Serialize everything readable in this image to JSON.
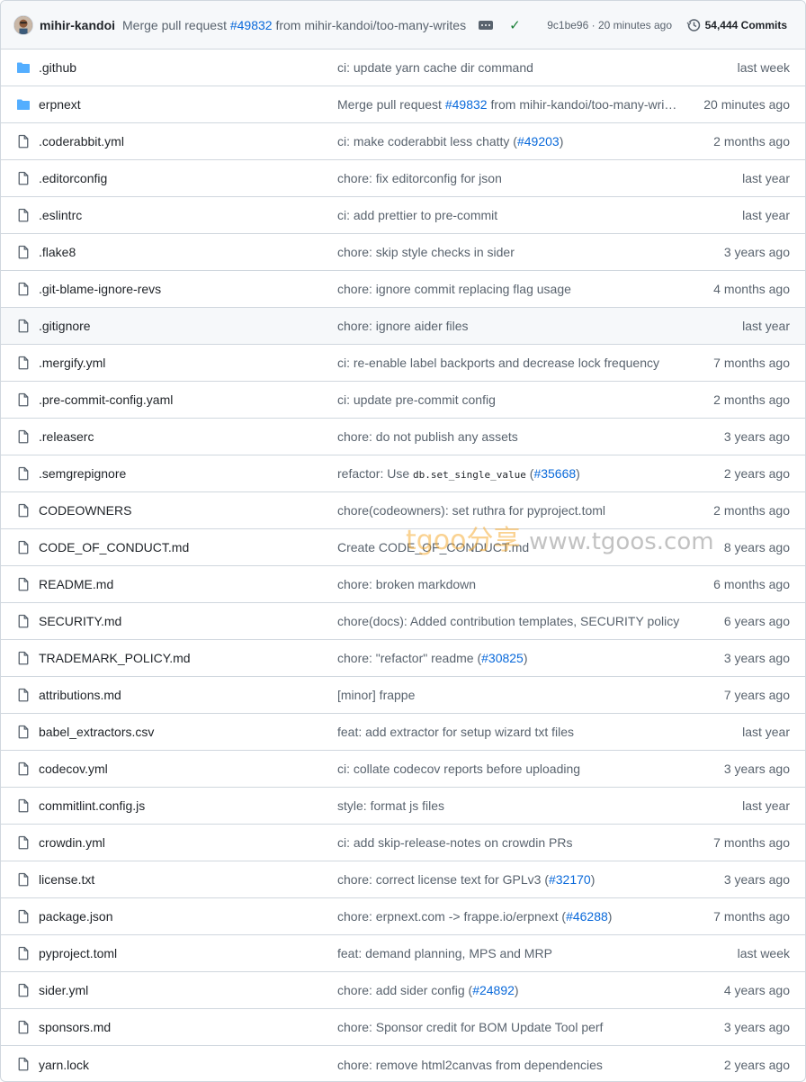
{
  "header": {
    "author": "mihir-kandoi",
    "message_prefix": "Merge pull request ",
    "message_link": "#49832",
    "message_suffix": " from mihir-kandoi/too-many-writes",
    "sha_time": "9c1be96 · 20 minutes ago",
    "commits": "54,444 Commits",
    "icons": [
      "avatar",
      "ellipsis-icon",
      "check-icon",
      "history-icon"
    ]
  },
  "rows": [
    {
      "name": ".github",
      "type": "dir",
      "msg": [
        {
          "t": "ci: update yarn cache dir command"
        }
      ],
      "age": "last week"
    },
    {
      "name": "erpnext",
      "type": "dir",
      "msg": [
        {
          "t": "Merge pull request "
        },
        {
          "t": "#49832",
          "link": true
        },
        {
          "t": " from mihir-kandoi/too-many-wri…"
        }
      ],
      "age": "20 minutes ago"
    },
    {
      "name": ".coderabbit.yml",
      "type": "file",
      "msg": [
        {
          "t": "ci: make coderabbit less chatty ("
        },
        {
          "t": "#49203",
          "link": true
        },
        {
          "t": ")"
        }
      ],
      "age": "2 months ago"
    },
    {
      "name": ".editorconfig",
      "type": "file",
      "msg": [
        {
          "t": "chore: fix editorconfig for json"
        }
      ],
      "age": "last year"
    },
    {
      "name": ".eslintrc",
      "type": "file",
      "msg": [
        {
          "t": "ci: add prettier to pre-commit"
        }
      ],
      "age": "last year"
    },
    {
      "name": ".flake8",
      "type": "file",
      "msg": [
        {
          "t": "chore: skip style checks in sider"
        }
      ],
      "age": "3 years ago"
    },
    {
      "name": ".git-blame-ignore-revs",
      "type": "file",
      "msg": [
        {
          "t": "chore: ignore commit replacing flag usage"
        }
      ],
      "age": "4 months ago"
    },
    {
      "name": ".gitignore",
      "type": "file",
      "msg": [
        {
          "t": "chore: ignore aider files"
        }
      ],
      "age": "last year",
      "highlight": true
    },
    {
      "name": ".mergify.yml",
      "type": "file",
      "msg": [
        {
          "t": "ci: re-enable label backports and decrease lock frequency"
        }
      ],
      "age": "7 months ago"
    },
    {
      "name": ".pre-commit-config.yaml",
      "type": "file",
      "msg": [
        {
          "t": "ci: update pre-commit config"
        }
      ],
      "age": "2 months ago"
    },
    {
      "name": ".releaserc",
      "type": "file",
      "msg": [
        {
          "t": "chore: do not publish any assets"
        }
      ],
      "age": "3 years ago"
    },
    {
      "name": ".semgrepignore",
      "type": "file",
      "msg": [
        {
          "t": "refactor: Use "
        },
        {
          "t": "db.set_single_value",
          "code": true
        },
        {
          "t": " ("
        },
        {
          "t": "#35668",
          "link": true
        },
        {
          "t": ")"
        }
      ],
      "age": "2 years ago"
    },
    {
      "name": "CODEOWNERS",
      "type": "file",
      "msg": [
        {
          "t": "chore(codeowners): set ruthra for pyproject.toml"
        }
      ],
      "age": "2 months ago"
    },
    {
      "name": "CODE_OF_CONDUCT.md",
      "type": "file",
      "msg": [
        {
          "t": "Create CODE_OF_CONDUCT.md"
        }
      ],
      "age": "8 years ago"
    },
    {
      "name": "README.md",
      "type": "file",
      "msg": [
        {
          "t": "chore: broken markdown"
        }
      ],
      "age": "6 months ago"
    },
    {
      "name": "SECURITY.md",
      "type": "file",
      "msg": [
        {
          "t": "chore(docs): Added contribution templates, SECURITY policy"
        }
      ],
      "age": "6 years ago"
    },
    {
      "name": "TRADEMARK_POLICY.md",
      "type": "file",
      "msg": [
        {
          "t": "chore: \"refactor\" readme ("
        },
        {
          "t": "#30825",
          "link": true
        },
        {
          "t": ")"
        }
      ],
      "age": "3 years ago"
    },
    {
      "name": "attributions.md",
      "type": "file",
      "msg": [
        {
          "t": "[minor] frappe"
        }
      ],
      "age": "7 years ago"
    },
    {
      "name": "babel_extractors.csv",
      "type": "file",
      "msg": [
        {
          "t": "feat: add extractor for setup wizard txt files"
        }
      ],
      "age": "last year"
    },
    {
      "name": "codecov.yml",
      "type": "file",
      "msg": [
        {
          "t": "ci: collate codecov reports before uploading"
        }
      ],
      "age": "3 years ago"
    },
    {
      "name": "commitlint.config.js",
      "type": "file",
      "msg": [
        {
          "t": "style: format js files"
        }
      ],
      "age": "last year"
    },
    {
      "name": "crowdin.yml",
      "type": "file",
      "msg": [
        {
          "t": "ci: add skip-release-notes on crowdin PRs"
        }
      ],
      "age": "7 months ago"
    },
    {
      "name": "license.txt",
      "type": "file",
      "msg": [
        {
          "t": "chore: correct license text for GPLv3 ("
        },
        {
          "t": "#32170",
          "link": true
        },
        {
          "t": ")"
        }
      ],
      "age": "3 years ago"
    },
    {
      "name": "package.json",
      "type": "file",
      "msg": [
        {
          "t": "chore: erpnext.com -> frappe.io/erpnext ("
        },
        {
          "t": "#46288",
          "link": true
        },
        {
          "t": ")"
        }
      ],
      "age": "7 months ago"
    },
    {
      "name": "pyproject.toml",
      "type": "file",
      "msg": [
        {
          "t": "feat: demand planning, MPS and MRP"
        }
      ],
      "age": "last week"
    },
    {
      "name": "sider.yml",
      "type": "file",
      "msg": [
        {
          "t": "chore: add sider config ("
        },
        {
          "t": "#24892",
          "link": true
        },
        {
          "t": ")"
        }
      ],
      "age": "4 years ago"
    },
    {
      "name": "sponsors.md",
      "type": "file",
      "msg": [
        {
          "t": "chore: Sponsor credit for BOM Update Tool perf"
        }
      ],
      "age": "3 years ago"
    },
    {
      "name": "yarn.lock",
      "type": "file",
      "msg": [
        {
          "t": "chore: remove html2canvas from dependencies"
        }
      ],
      "age": "2 years ago"
    }
  ],
  "watermark": {
    "brand": "tgoo分享",
    "url": "www.tgoos.com"
  }
}
